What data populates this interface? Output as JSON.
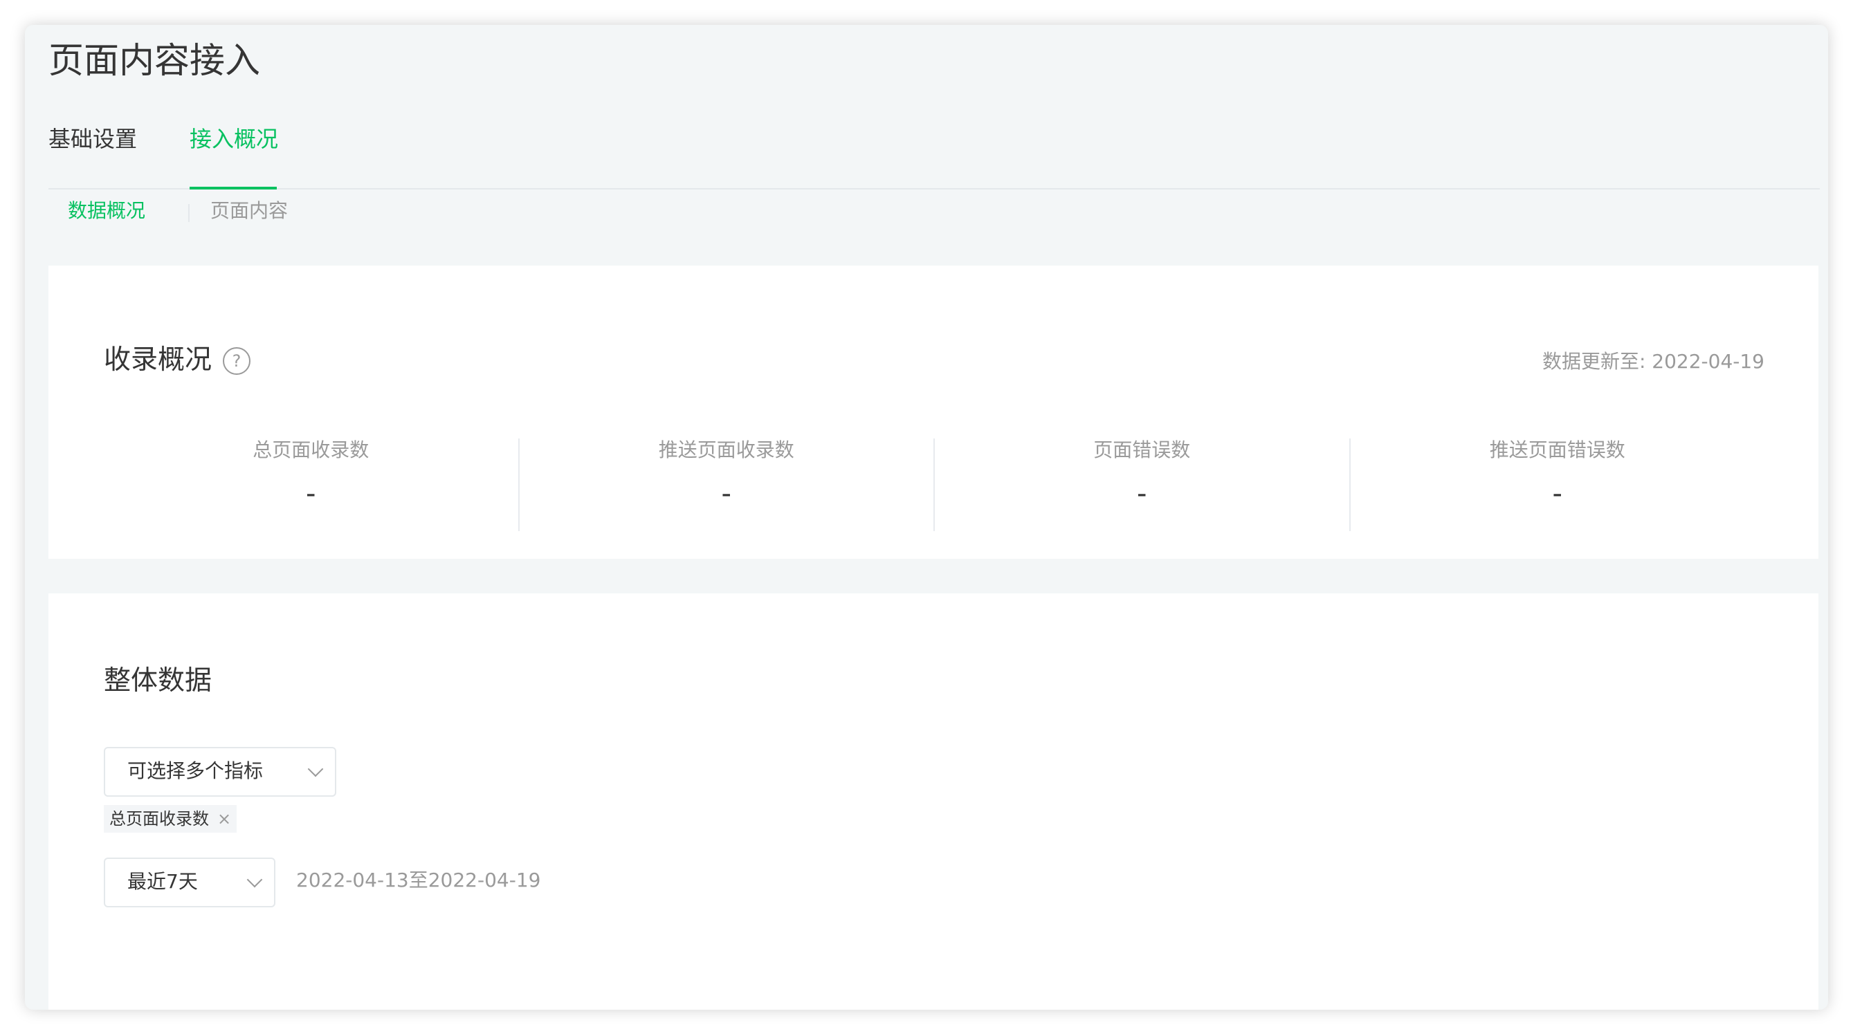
{
  "page": {
    "title": "页面内容接入"
  },
  "tabs": {
    "basic": "基础设置",
    "overview": "接入概况"
  },
  "subnav": {
    "data": "数据概况",
    "content": "页面内容"
  },
  "overview_card": {
    "title": "收录概况",
    "help": "?",
    "update_label": "数据更新至: 2022-04-19",
    "stats": [
      {
        "label": "总页面收录数",
        "value": "-"
      },
      {
        "label": "推送页面收录数",
        "value": "-"
      },
      {
        "label": "页面错误数",
        "value": "-"
      },
      {
        "label": "推送页面错误数",
        "value": "-"
      }
    ]
  },
  "overall_card": {
    "title": "整体数据",
    "metric_select": "可选择多个指标",
    "selected_tag": "总页面收录数",
    "tag_close": "×",
    "range_select": "最近7天",
    "range_text": "2022-04-13至2022-04-19"
  },
  "colors": {
    "accent": "#07c160",
    "text": "#353535",
    "muted": "#9a9a9a",
    "page_bg": "#f3f6f7"
  },
  "icons": {
    "help": "help-circle-icon",
    "chevron": "chevron-down-icon",
    "close": "close-icon"
  }
}
